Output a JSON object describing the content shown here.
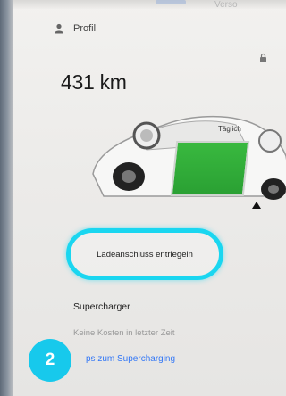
{
  "top": {
    "faint_label": "Verso"
  },
  "profile": {
    "label": "Profil",
    "icon": "person-icon"
  },
  "vehicle": {
    "range": "431 km"
  },
  "charging": {
    "daily_label": "Täglich",
    "panel_color": "#34b53a",
    "unlock_button": {
      "label": "Ladeanschluss entriegeln",
      "highlight_color": "#1ad6f0"
    }
  },
  "supercharger": {
    "title": "Supercharger",
    "subtitle": "Keine Kosten in letzter Zeit",
    "link": "ps zum Supercharging"
  },
  "annotation": {
    "step": "2",
    "color": "#17c9ec"
  }
}
